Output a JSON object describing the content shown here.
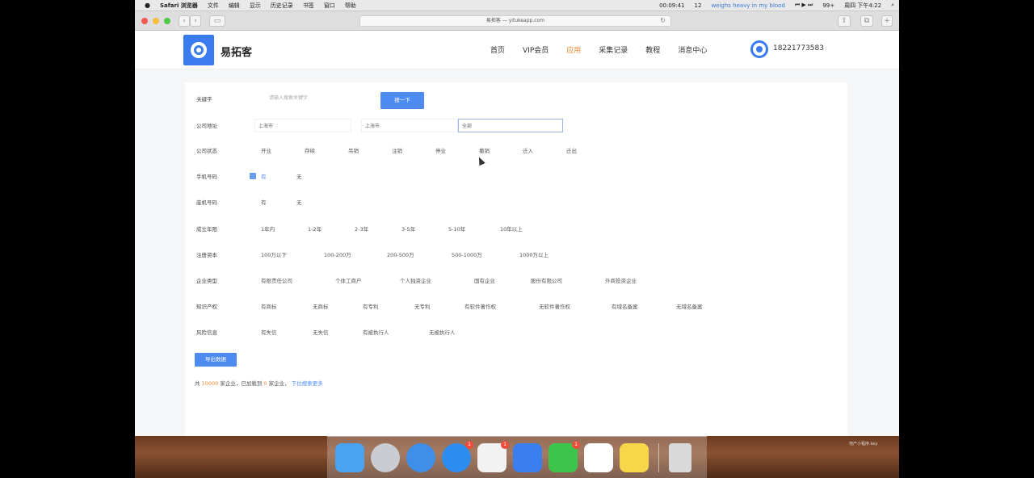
{
  "menubar": {
    "apple": "",
    "app": "Safari 浏览器",
    "items": [
      "文件",
      "编辑",
      "显示",
      "历史记录",
      "书签",
      "窗口",
      "帮助"
    ],
    "timer": "00:09:41",
    "count": "12",
    "now_playing": "weighs heavy in my blood",
    "battery": "99+",
    "clock": "周四 下午4:22"
  },
  "toolbar": {
    "back": "‹",
    "forward": "›",
    "url": "易拓客 — yitukeapp.com"
  },
  "header": {
    "brand": "易拓客",
    "nav": [
      {
        "label": "首页",
        "active": false
      },
      {
        "label": "VIP会员",
        "active": false
      },
      {
        "label": "应用",
        "active": true
      },
      {
        "label": "采集记录",
        "active": false
      },
      {
        "label": "教程",
        "active": false
      },
      {
        "label": "消息中心",
        "active": false
      }
    ],
    "phone": "18221773583"
  },
  "filters": {
    "keyword": {
      "label": "关键字",
      "placeholder": "请输入搜索关键字",
      "button": "搜一下"
    },
    "address": {
      "label": "公司地址",
      "province": "上海市",
      "city": "上海市",
      "district": "全部"
    },
    "status": {
      "label": "公司状态",
      "options": [
        "开业",
        "存续",
        "吊销",
        "注销",
        "停业",
        "撤销",
        "迁入",
        "迁出"
      ]
    },
    "mobile": {
      "label": "手机号码",
      "options": [
        "有",
        "无"
      ],
      "selected": "有"
    },
    "landline": {
      "label": "座机号码",
      "options": [
        "有",
        "无"
      ]
    },
    "years": {
      "label": "成立年限",
      "options": [
        "1年内",
        "1-2年",
        "2-3年",
        "3-5年",
        "5-10年",
        "10年以上"
      ]
    },
    "capital": {
      "label": "注册资本",
      "options": [
        "100万以下",
        "100-200万",
        "200-500万",
        "500-1000万",
        "1000万以上"
      ]
    },
    "type": {
      "label": "企业类型",
      "options": [
        "有限责任公司",
        "个体工商户",
        "个人独资企业",
        "国有企业",
        "股份有限公司",
        "外商投资企业"
      ]
    },
    "ip": {
      "label": "知识产权",
      "options": [
        "有商标",
        "无商标",
        "有专利",
        "无专利",
        "有软件著作权",
        "无软件著作权",
        "有域名备案",
        "无域名备案"
      ]
    },
    "risk": {
      "label": "风险信息",
      "options": [
        "有失信",
        "无失信",
        "有被执行人",
        "无被执行人"
      ]
    }
  },
  "export_button": "导出数据",
  "summary": {
    "prefix": "共",
    "total": "10000",
    "mid": "家企业，已加载到",
    "loaded": "0",
    "suffix": "家企业，",
    "link": "下拉搜索更多"
  },
  "dock": {
    "apps": [
      {
        "name": "finder",
        "color": "#4aa3f0"
      },
      {
        "name": "launchpad",
        "color": "#c9ccd2"
      },
      {
        "name": "safari",
        "color": "#3f8fe8"
      },
      {
        "name": "app-store",
        "color": "#2d8cf0",
        "badge": "1"
      },
      {
        "name": "qq",
        "color": "#f2f2f2",
        "badge": "1"
      },
      {
        "name": "lark",
        "color": "#3b7ef0"
      },
      {
        "name": "wechat",
        "color": "#3dc44a",
        "badge": "1"
      },
      {
        "name": "wps",
        "color": "#ffffff"
      },
      {
        "name": "qq-music",
        "color": "#f7d749"
      },
      {
        "name": "trash",
        "color": "#d9d9d9"
      }
    ],
    "desktop_label": "地产小程序.key"
  }
}
